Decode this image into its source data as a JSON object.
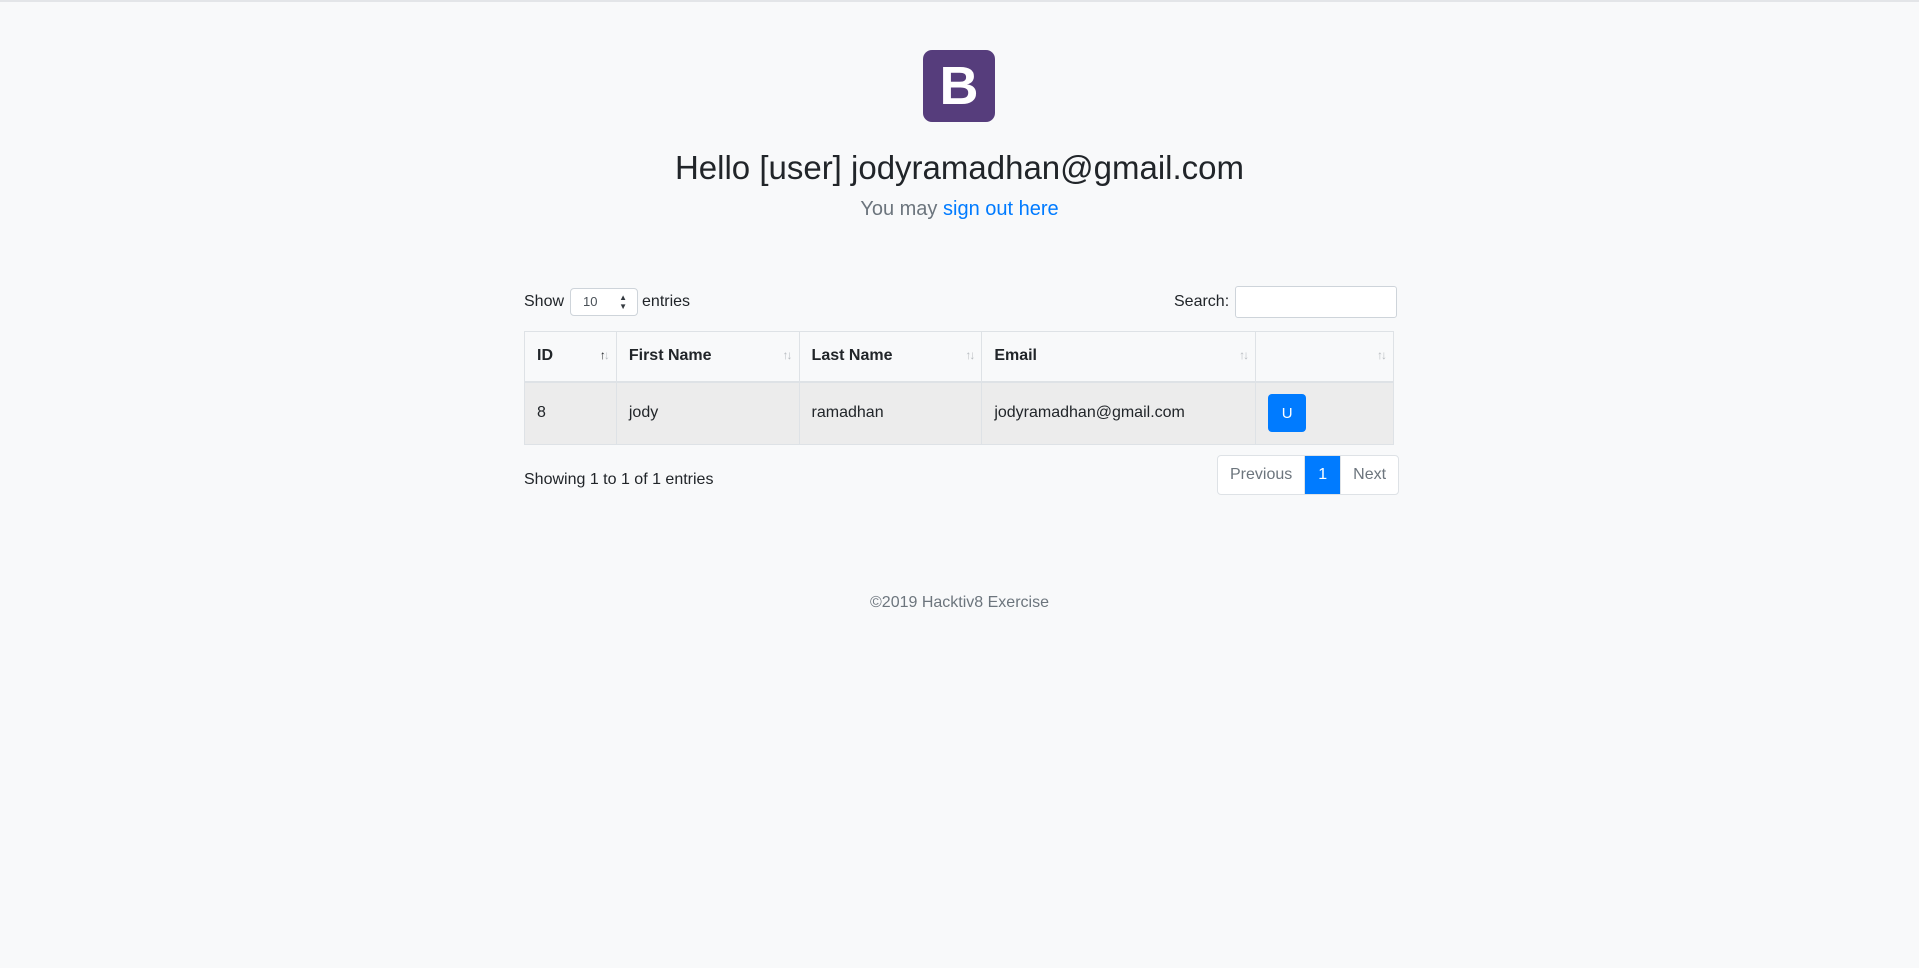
{
  "logo": {
    "letter": "B",
    "color": "#563d7c"
  },
  "header": {
    "greeting": "Hello [user] jodyramadhan@gmail.com",
    "signout_prefix": "You may",
    "signout_link": "sign out here"
  },
  "controls": {
    "show_label": "Show",
    "page_size": "10",
    "entries_label": "entries",
    "search_label": "Search:",
    "search_value": ""
  },
  "table": {
    "columns": [
      "ID",
      "First Name",
      "Last Name",
      "Email",
      ""
    ],
    "rows": [
      {
        "id": "8",
        "first_name": "jody",
        "last_name": "ramadhan",
        "email": "jodyramadhan@gmail.com",
        "action_label": "U"
      }
    ]
  },
  "info": "Showing 1 to 1 of 1 entries",
  "pagination": {
    "previous": "Previous",
    "current": "1",
    "next": "Next"
  },
  "footer": "©2019 Hacktiv8 Exercise",
  "colors": {
    "accent": "#007bff",
    "background": "#f8f9fa"
  }
}
